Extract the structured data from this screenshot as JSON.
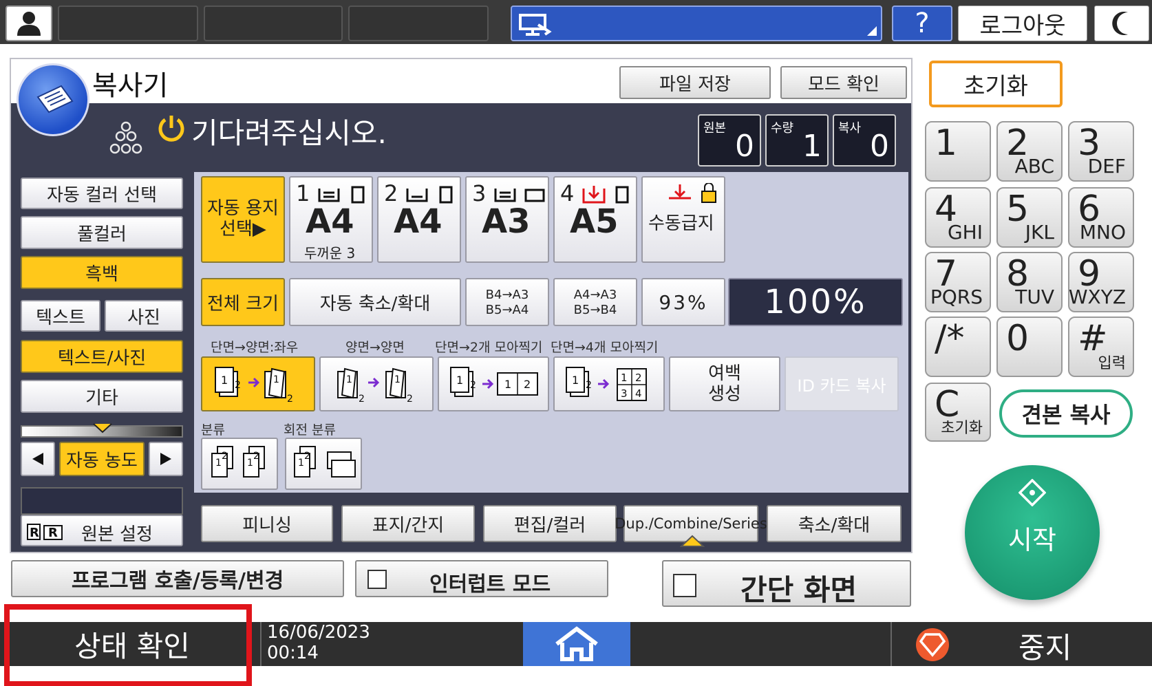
{
  "topbar": {
    "help_label": "?",
    "logout_label": "로그아웃"
  },
  "copier": {
    "app_title": "복사기",
    "file_save_label": "파일 저장",
    "mode_check_label": "모드 확인",
    "status_message": "기다려주십시오.",
    "counters": [
      {
        "label": "원본",
        "value": "0"
      },
      {
        "label": "수량",
        "value": "1"
      },
      {
        "label": "복사",
        "value": "0"
      }
    ],
    "color_modes": [
      "자동 컬러 선택",
      "풀컬러",
      "흑백"
    ],
    "selected_color_mode": "흑백",
    "original_types": {
      "text": "텍스트",
      "photo": "사진",
      "text_photo": "텍스트/사진",
      "other": "기타"
    },
    "density_label": "자동 농도",
    "original_settings_label": "원본 설정",
    "paper": {
      "auto_label_line1": "자동 용지",
      "auto_label_line2": "선택▶",
      "trays": [
        {
          "num": "1",
          "size": "A4",
          "note": "두꺼운 3"
        },
        {
          "num": "2",
          "size": "A4",
          "note": ""
        },
        {
          "num": "3",
          "size": "A3",
          "note": ""
        },
        {
          "num": "4",
          "size": "A5",
          "note": ""
        }
      ],
      "bypass_label": "수동급지"
    },
    "zoom": {
      "full_size": "전체 크기",
      "auto_reduce_enlarge": "자동 축소/확대",
      "preset1_line1": "B4→A3",
      "preset1_line2": "B5→A4",
      "preset2_line1": "A4→A3",
      "preset2_line2": "B5→B4",
      "percent": "93%",
      "current": "100%"
    },
    "duplex": {
      "labels": [
        "단면→양면:좌우",
        "양면→양면",
        "단면→2개 모아찍기",
        "단면→4개 모아찍기"
      ],
      "margin_line1": "여백",
      "margin_line2": "생성",
      "id_card": "ID 카드 복사"
    },
    "sort": {
      "sort_label": "분류",
      "rotate_sort_label": "회전 분류"
    },
    "tabs": [
      "피니싱",
      "표지/간지",
      "편집/컬러",
      "Dup./Combine/Series",
      "축소/확대"
    ]
  },
  "bottom_buttons": {
    "program": "프로그램 호출/등록/변경",
    "interrupt": "인터럽트 모드",
    "simple_screen": "간단 화면"
  },
  "keypad": {
    "reset_label": "초기화",
    "keys": [
      {
        "num": "1",
        "letters": ""
      },
      {
        "num": "2",
        "letters": "ABC"
      },
      {
        "num": "3",
        "letters": "DEF"
      },
      {
        "num": "4",
        "letters": "GHI"
      },
      {
        "num": "5",
        "letters": "JKL"
      },
      {
        "num": "6",
        "letters": "MNO"
      },
      {
        "num": "7",
        "letters": "PQRS"
      },
      {
        "num": "8",
        "letters": "TUV"
      },
      {
        "num": "9",
        "letters": "WXYZ"
      },
      {
        "num": "/*",
        "letters": ""
      },
      {
        "num": "0",
        "letters": ""
      },
      {
        "num": "#",
        "letters": "입력"
      }
    ],
    "clear_num": "C",
    "clear_label": "초기화",
    "sample_copy_label": "견본 복사",
    "start_label": "시작"
  },
  "statusbar": {
    "status_check_label": "상태 확인",
    "date": "16/06/2023",
    "time": "00:14",
    "stop_label": "중지"
  },
  "colors": {
    "highlight_yellow": "#ffc81a",
    "panel_dark": "#3a3d50",
    "start_green": "#22a67e",
    "home_blue": "#3f74d6",
    "annotation_red": "#e0151b"
  }
}
